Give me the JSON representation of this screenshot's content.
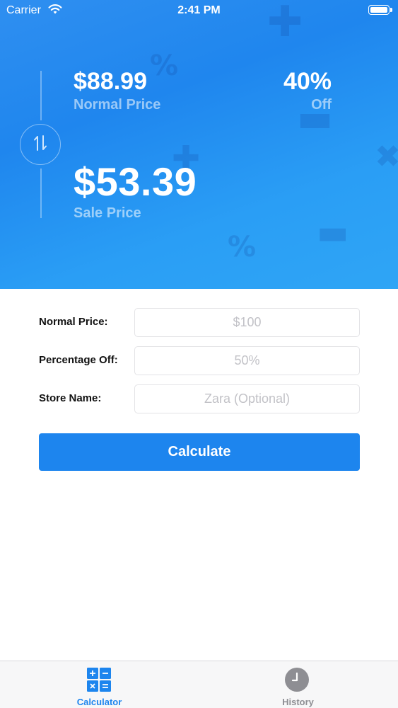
{
  "status_bar": {
    "carrier": "Carrier",
    "time": "2:41 PM"
  },
  "hero": {
    "normal_price_value": "$88.99",
    "normal_price_label": "Normal Price",
    "percent_off_value": "40%",
    "percent_off_label": "Off",
    "sale_price_value": "$53.39",
    "sale_price_label": "Sale Price"
  },
  "form": {
    "normal_price": {
      "label": "Normal Price:",
      "placeholder": "$100",
      "value": ""
    },
    "percentage_off": {
      "label": "Percentage Off:",
      "placeholder": "50%",
      "value": ""
    },
    "store_name": {
      "label": "Store Name:",
      "placeholder": "Zara (Optional)",
      "value": ""
    },
    "calculate_label": "Calculate"
  },
  "tab_bar": {
    "calculator_label": "Calculator",
    "history_label": "History"
  },
  "colors": {
    "accent": "#1d85ee",
    "hero_gradient_start": "#2f8ff0",
    "hero_gradient_end": "#2fa5f5",
    "inactive_tab": "#8e8e93"
  },
  "icons": {
    "swap": "swap-arrows-icon",
    "calculator": "calculator-icon",
    "history": "clock-icon"
  }
}
